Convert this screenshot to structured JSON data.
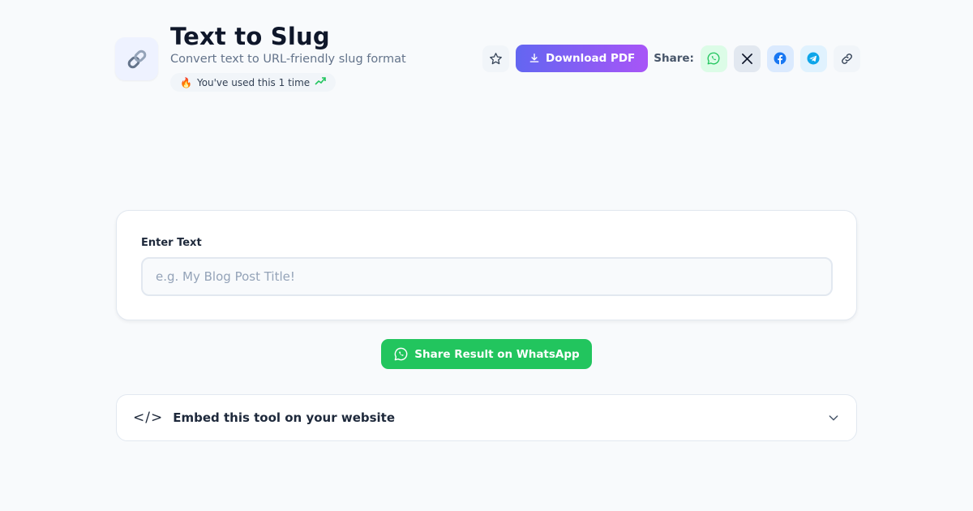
{
  "header": {
    "icon": "link-icon",
    "title": "Text to Slug",
    "subtitle": "Convert text to URL-friendly slug format",
    "usage_text": "You've used this 1 time"
  },
  "toolbar": {
    "download_label": "Download PDF",
    "share_label": "Share:"
  },
  "form": {
    "label": "Enter Text",
    "value": "",
    "placeholder": "e.g. My Blog Post Title!"
  },
  "share_whatsapp_label": "Share Result on WhatsApp",
  "embed": {
    "icon_text": "</>",
    "title": "Embed this tool on your website"
  },
  "colors": {
    "accent_gradient_start": "#6366f1",
    "accent_gradient_end": "#a855f7",
    "whatsapp_green": "#22c55e",
    "facebook_blue": "#1877f2",
    "telegram_blue": "#0ea5e9"
  }
}
